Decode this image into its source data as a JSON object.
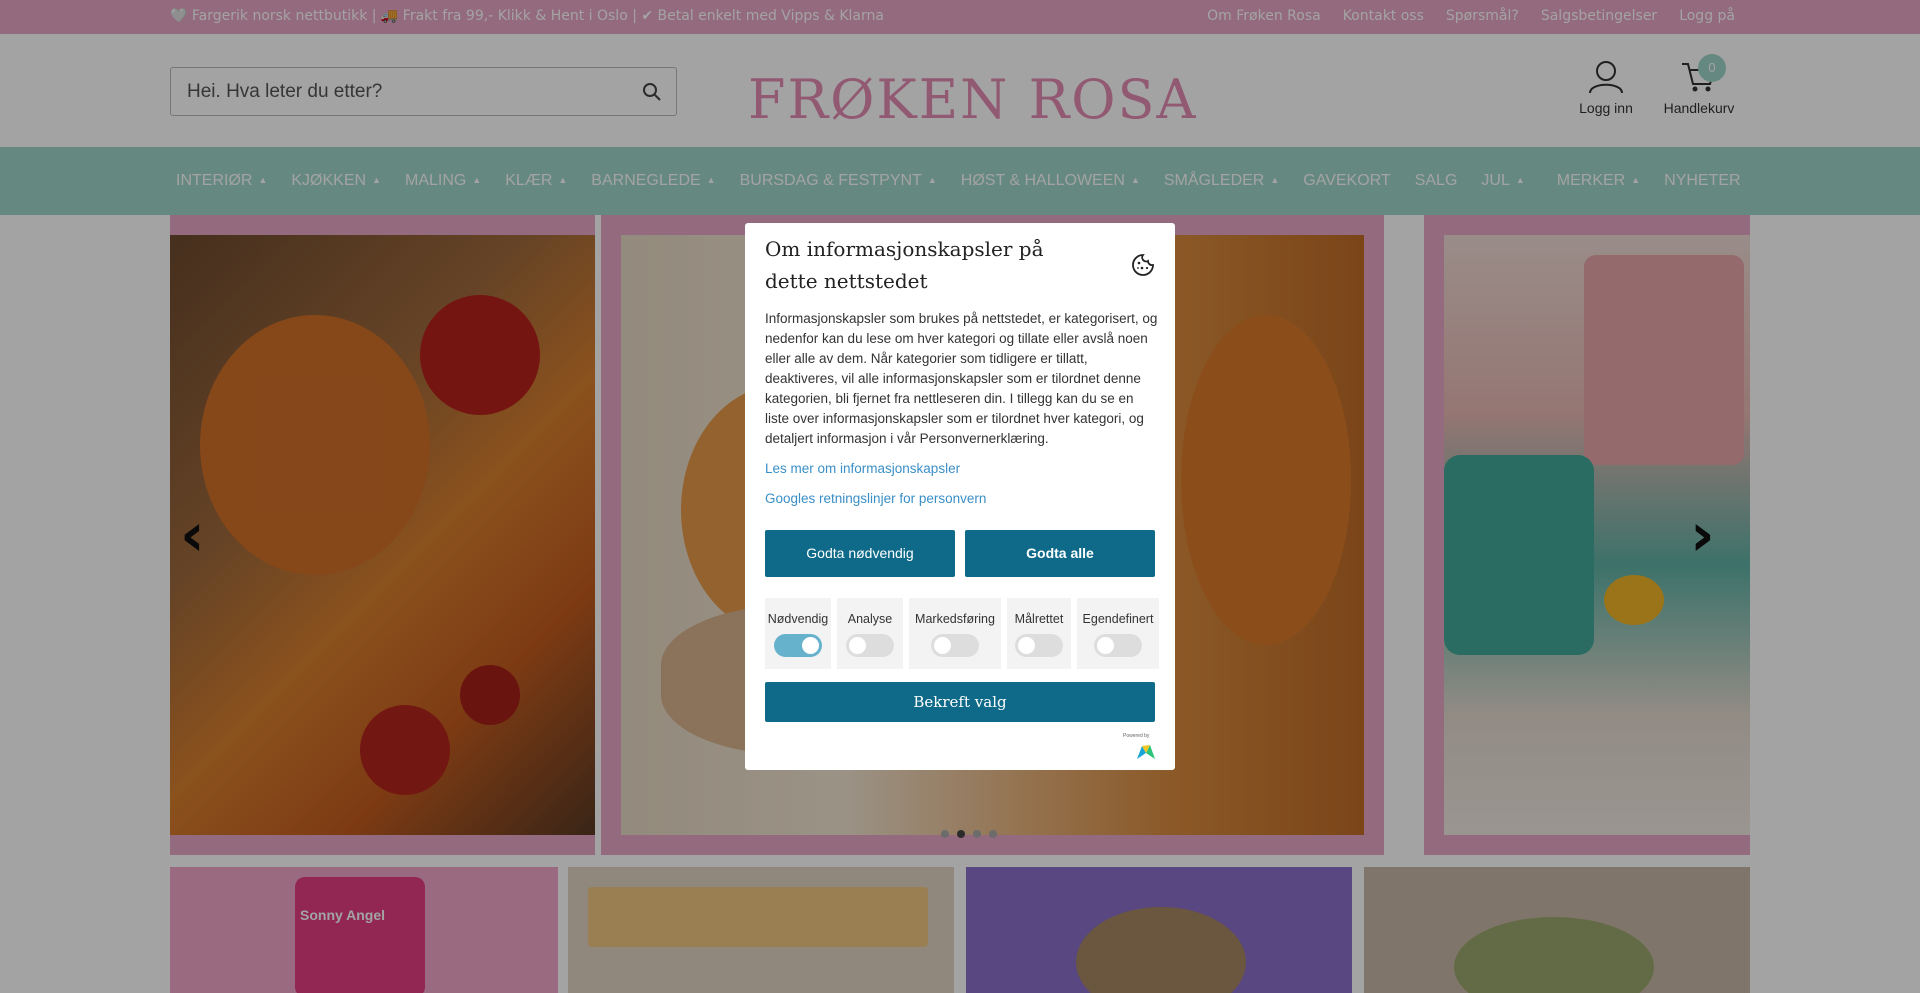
{
  "topbar": {
    "usp": "🤍 Fargerik norsk nettbutikk | 🚚 Frakt fra 99,- Klikk & Hent i Oslo | ✔ Betal enkelt med Vipps & Klarna",
    "links": [
      "Om Frøken Rosa",
      "Kontakt oss",
      "Spørsmål?",
      "Salgsbetingelser",
      "Logg på"
    ]
  },
  "header": {
    "search_placeholder": "Hei. Hva leter du etter?",
    "logo": "FRØKEN ROSA",
    "login_label": "Logg inn",
    "cart_label": "Handlekurv",
    "cart_count": "0"
  },
  "nav": {
    "items": [
      {
        "label": "INTERIØR",
        "dropdown": "▲"
      },
      {
        "label": "KJØKKEN",
        "dropdown": "▲"
      },
      {
        "label": "MALING",
        "dropdown": "▲"
      },
      {
        "label": "KLÆR",
        "dropdown": "▲"
      },
      {
        "label": "BARNEGLEDE",
        "dropdown": "▲"
      },
      {
        "label": "BURSDAG & FESTPYNT",
        "dropdown": "▲"
      },
      {
        "label": "HØST & HALLOWEEN",
        "dropdown": "▲"
      },
      {
        "label": "SMÅGLEDER",
        "dropdown": "▲"
      },
      {
        "label": "GAVEKORT",
        "dropdown": ""
      },
      {
        "label": "SALG",
        "dropdown": ""
      },
      {
        "label": "JUL",
        "dropdown": "▲"
      },
      {
        "label": "MERKER",
        "dropdown": "▲"
      },
      {
        "label": "NYHETER",
        "dropdown": ""
      }
    ]
  },
  "slider": {
    "prev": "‹",
    "next": "›",
    "dot_count": 4,
    "active_dot": 1
  },
  "tiles": [
    {
      "text": "Sonny Angel"
    },
    {
      "text": ""
    },
    {
      "text": ""
    },
    {
      "text": ""
    }
  ],
  "cookie": {
    "title": "Om informasjonskapsler på dette nettstedet",
    "body": "Informasjonskapsler som brukes på nettstedet, er kategorisert, og nedenfor kan du lese om hver kategori og tillate eller avslå noen eller alle av dem. Når kategorier som tidligere er tillatt, deaktiveres, vil alle informasjonskapsler som er tilordnet denne kategorien, bli fjernet fra nettleseren din. I tillegg kan du se en liste over informasjonskapsler som er tilordnet hver kategori, og detaljert informasjon i vår Personvernerklæring.",
    "link1": "Les mer om informasjonskapsler",
    "link2": "Googles retningslinjer for personvern",
    "btn_necessary": "Godta nødvendig",
    "btn_all": "Godta alle",
    "categories": [
      {
        "label": "Nødvendig",
        "on": true
      },
      {
        "label": "Analyse",
        "on": false
      },
      {
        "label": "Markedsføring",
        "on": false
      },
      {
        "label": "Målrettet",
        "on": false
      },
      {
        "label": "Egendefinert",
        "on": false
      }
    ],
    "confirm": "Bekreft valg",
    "powered": "Powered by"
  },
  "colors": {
    "pink": "#e8a6c6",
    "mint": "#9fd6c9",
    "button": "#0e6a88",
    "link": "#3a8fc7",
    "logo": "#e48bb3"
  }
}
